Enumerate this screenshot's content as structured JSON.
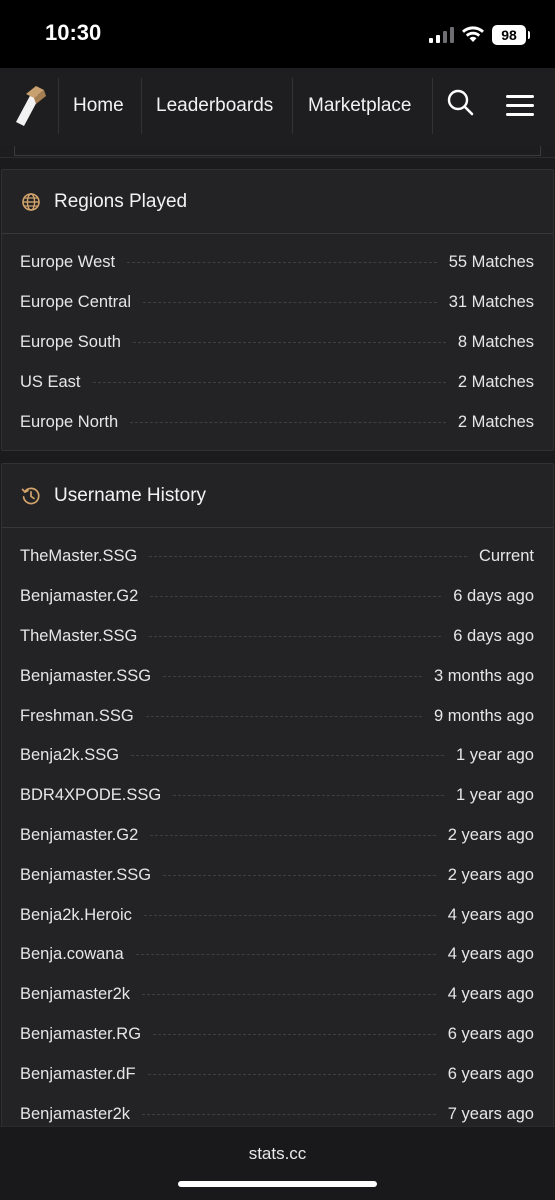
{
  "status_bar": {
    "time": "10:30",
    "battery": "98"
  },
  "nav": {
    "links": [
      "Home",
      "Leaderboards",
      "Marketplace"
    ],
    "icons": [
      "logo-icon",
      "search-icon",
      "hamburger-menu-icon"
    ],
    "logo_color": "#c9a070"
  },
  "regions": {
    "title": "Regions Played",
    "icon": "globe-icon",
    "rows": [
      {
        "label": "Europe West",
        "value": "55 Matches"
      },
      {
        "label": "Europe Central",
        "value": "31 Matches"
      },
      {
        "label": "Europe South",
        "value": "8 Matches"
      },
      {
        "label": "US East",
        "value": "2 Matches"
      },
      {
        "label": "Europe North",
        "value": "2 Matches"
      }
    ]
  },
  "username_history": {
    "title": "Username History",
    "icon": "history-icon",
    "rows": [
      {
        "label": "TheMaster.SSG",
        "value": "Current"
      },
      {
        "label": "Benjamaster.G2",
        "value": "6 days ago"
      },
      {
        "label": "TheMaster.SSG",
        "value": "6 days ago"
      },
      {
        "label": "Benjamaster.SSG",
        "value": "3 months ago"
      },
      {
        "label": "Freshman.SSG",
        "value": "9 months ago"
      },
      {
        "label": "Benja2k.SSG",
        "value": "1 year ago"
      },
      {
        "label": "BDR4XPODE.SSG",
        "value": "1 year ago"
      },
      {
        "label": "Benjamaster.G2",
        "value": "2 years ago"
      },
      {
        "label": "Benjamaster.SSG",
        "value": "2 years ago"
      },
      {
        "label": "Benja2k.Heroic",
        "value": "4 years ago"
      },
      {
        "label": "Benja.cowana",
        "value": "4 years ago"
      },
      {
        "label": "Benjamaster2k",
        "value": "4 years ago"
      },
      {
        "label": "Benjamaster.RG",
        "value": "6 years ago"
      },
      {
        "label": "Benjamaster.dF",
        "value": "6 years ago"
      },
      {
        "label": "Benjamaster2k",
        "value": "7 years ago"
      }
    ]
  },
  "browser": {
    "url": "stats.cc"
  }
}
